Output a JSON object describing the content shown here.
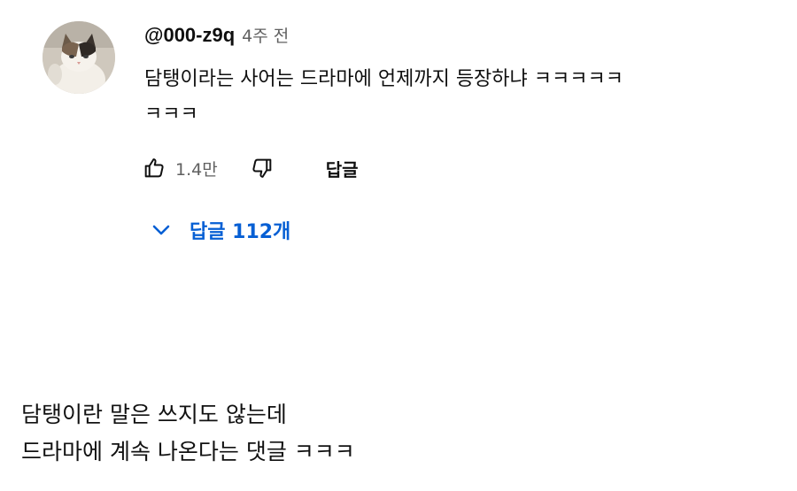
{
  "comment": {
    "author": "@000-z9q",
    "time": "4주 전",
    "text": "담탱이라는 사어는 드라마에 언제까지 등장하냐 ㅋㅋㅋㅋㅋ\nㅋㅋㅋ",
    "like_count": "1.4만",
    "reply_label": "답글",
    "replies_toggle": "답글 112개",
    "avatar_icon": "cat-avatar",
    "like_icon": "thumbs-up-icon",
    "dislike_icon": "thumbs-down-icon",
    "chevron_icon": "chevron-down-icon"
  },
  "caption": {
    "line1": "담탱이란 말은 쓰지도 않는데",
    "line2": "드라마에 계속 나온다는 댓글 ㅋㅋㅋ"
  },
  "colors": {
    "link_blue": "#065fd4",
    "meta_gray": "#606060",
    "text": "#0f0f0f"
  }
}
